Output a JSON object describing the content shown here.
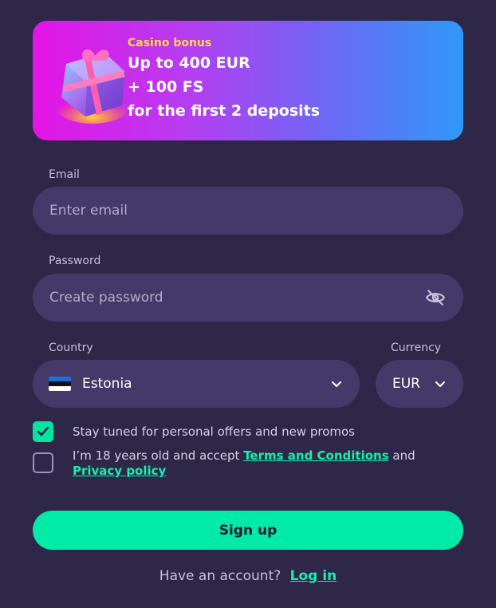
{
  "banner": {
    "tag": "Casino bonus",
    "line1": "Up to 400 EUR",
    "line2": "+ 100 FS",
    "line3": "for the first 2 deposits"
  },
  "email": {
    "label": "Email",
    "placeholder": "Enter email"
  },
  "password": {
    "label": "Password",
    "placeholder": "Create password"
  },
  "country": {
    "label": "Country",
    "value": "Estonia"
  },
  "currency": {
    "label": "Currency",
    "value": "EUR"
  },
  "checks": {
    "promos_label": "Stay tuned for personal offers and new promos",
    "promos_checked": true,
    "age_prefix": "I’m 18 years old and accept ",
    "terms_link": "Terms and Conditions",
    "age_and": " and ",
    "privacy_link": "Privacy policy",
    "age_checked": false
  },
  "signup_label": "Sign up",
  "footer": {
    "prompt": "Have an account?",
    "login_link": "Log in"
  },
  "colors": {
    "background": "#2e2748",
    "field": "#443a6a",
    "accent": "#00eaa8",
    "banner_tag": "#ffd84a"
  }
}
